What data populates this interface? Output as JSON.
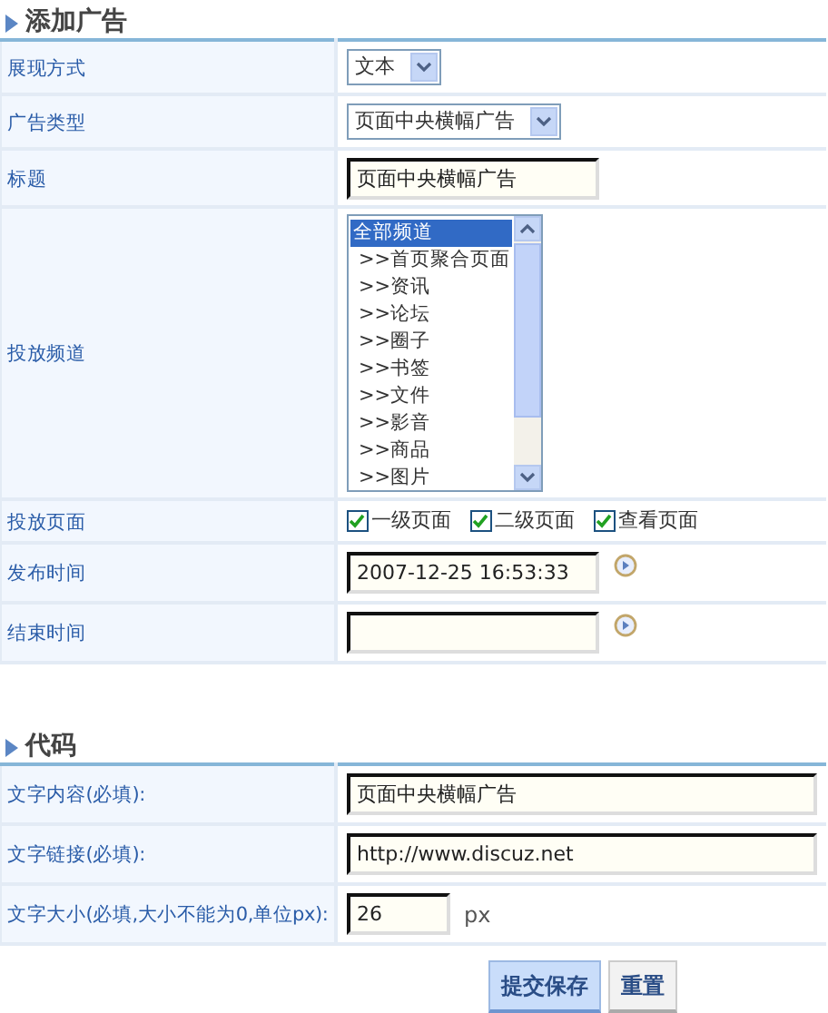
{
  "sections": [
    {
      "title": "添加广告",
      "rows": [
        {
          "kind": "select",
          "label": "展现方式",
          "value": "文本"
        },
        {
          "kind": "select",
          "label": "广告类型",
          "value": "页面中央横幅广告"
        },
        {
          "kind": "text",
          "label": "标题",
          "value": "页面中央横幅广告"
        },
        {
          "kind": "listbox",
          "label": "投放频道",
          "options": [
            {
              "text": "全部频道",
              "selected": true,
              "children": [
                {
                  "text": ">>首页聚合页面",
                  "selected": false
                },
                {
                  "text": ">>资讯",
                  "selected": false
                },
                {
                  "text": ">>论坛",
                  "selected": false
                },
                {
                  "text": ">>圈子",
                  "selected": false
                },
                {
                  "text": ">>书签",
                  "selected": false
                },
                {
                  "text": ">>文件",
                  "selected": false
                },
                {
                  "text": ">>影音",
                  "selected": false
                },
                {
                  "text": ">>商品",
                  "selected": false
                },
                {
                  "text": ">>图片",
                  "selected": false
                }
              ]
            }
          ]
        },
        {
          "kind": "checkboxes",
          "label": "投放页面",
          "options": [
            {
              "text": "一级页面",
              "checked": true
            },
            {
              "text": "二级页面",
              "checked": true
            },
            {
              "text": "查看页面",
              "checked": true
            }
          ]
        },
        {
          "kind": "date",
          "label": "发布时间",
          "value": "2007-12-25 16:53:33"
        },
        {
          "kind": "date",
          "label": "结束时间"
        }
      ]
    },
    {
      "title": "代码",
      "rows": [
        {
          "kind": "text",
          "label": "文字内容(必填):",
          "value": "页面中央横幅广告"
        },
        {
          "kind": "text",
          "label": "文字链接(必填):",
          "value": "http://www.discuz.net"
        },
        {
          "kind": "number",
          "label": "文字大小(必填,大小不能为0,单位px):",
          "value": "26",
          "unit": "px"
        }
      ]
    }
  ],
  "buttons": [
    {
      "label": "提交保存",
      "primary": true
    },
    {
      "label": "重置",
      "primary": false
    }
  ]
}
